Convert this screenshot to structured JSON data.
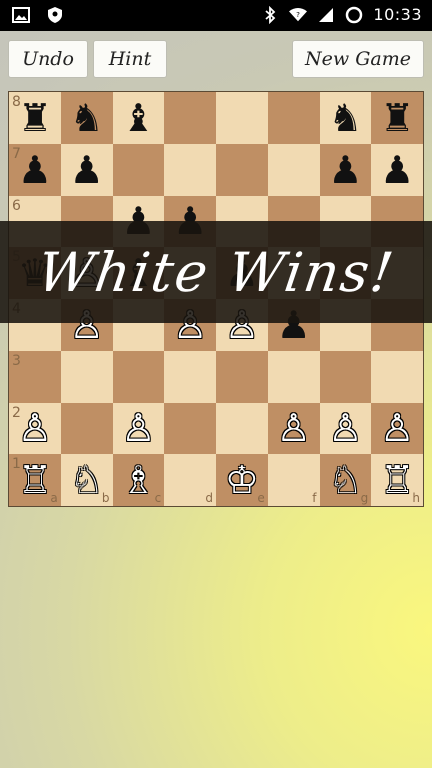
{
  "status_bar": {
    "time": "10:33",
    "left_icons": [
      "image-icon",
      "shield-icon"
    ],
    "right_icons": [
      "bluetooth-icon",
      "wifi-icon",
      "signal-icon",
      "sync-icon"
    ]
  },
  "toolbar": {
    "undo_label": "Undo",
    "hint_label": "Hint",
    "new_game_label": "New Game"
  },
  "board": {
    "ranks": [
      "8",
      "7",
      "6",
      "5",
      "4",
      "3",
      "2",
      "1"
    ],
    "files": [
      "a",
      "b",
      "c",
      "d",
      "e",
      "f",
      "g",
      "h"
    ],
    "position": [
      [
        "♜",
        "♞",
        "♝",
        "",
        "",
        "",
        "♞",
        "♜"
      ],
      [
        "♟",
        "♟",
        "",
        "",
        "",
        "",
        "♟",
        "♟"
      ],
      [
        "",
        "",
        "♟",
        "♟",
        "",
        "",
        "",
        ""
      ],
      [
        "♛",
        "♙",
        "♝",
        "",
        "♟",
        "",
        "",
        ""
      ],
      [
        "",
        "♙",
        "",
        "♙",
        "♙",
        "♟",
        "",
        ""
      ],
      [
        "",
        "",
        "",
        "",
        "",
        "",
        "",
        ""
      ],
      [
        "♙",
        "",
        "♙",
        "",
        "",
        "♙",
        "♙",
        "♙"
      ],
      [
        "♖",
        "♘",
        "♗",
        "",
        "♔",
        "",
        "♘",
        "♖"
      ]
    ],
    "colors": [
      [
        "b",
        "b",
        "b",
        "",
        "",
        "",
        "b",
        "b"
      ],
      [
        "b",
        "b",
        "",
        "",
        "",
        "",
        "b",
        "b"
      ],
      [
        "",
        "",
        "b",
        "b",
        "",
        "",
        "",
        ""
      ],
      [
        "b",
        "w",
        "b",
        "",
        "b",
        "",
        "",
        ""
      ],
      [
        "",
        "w",
        "",
        "w",
        "w",
        "b",
        "",
        ""
      ],
      [
        "",
        "",
        "",
        "",
        "",
        "",
        "",
        ""
      ],
      [
        "w",
        "",
        "w",
        "",
        "",
        "w",
        "w",
        "w"
      ],
      [
        "w",
        "w",
        "w",
        "",
        "w",
        "",
        "w",
        "w"
      ]
    ]
  },
  "result_banner": "White Wins!"
}
